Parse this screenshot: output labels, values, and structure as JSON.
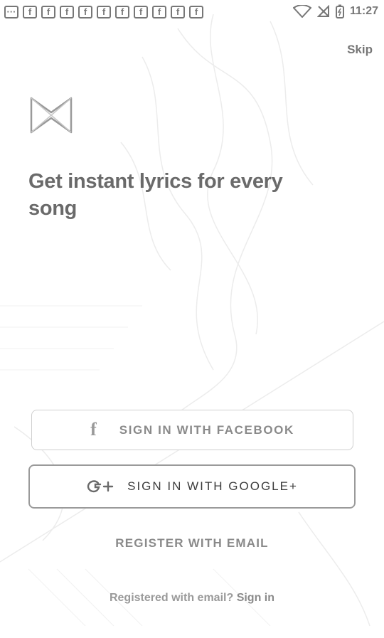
{
  "status_bar": {
    "notifications": [
      "f",
      "f",
      "f",
      "f",
      "f",
      "f",
      "f",
      "f",
      "f",
      "f",
      "f"
    ],
    "time": "11:27"
  },
  "onboarding": {
    "skip_label": "Skip",
    "headline": "Get instant lyrics for every song",
    "facebook_label": "SIGN IN WITH FACEBOOK",
    "google_label": "SIGN IN WITH GOOGLE+",
    "register_label": "REGISTER WITH EMAIL",
    "registered_prompt": "Registered with email?",
    "signin_link": "Sign in"
  },
  "icons": {
    "logo": "musixmatch-logo-icon",
    "facebook": "facebook-icon",
    "google": "google-plus-icon"
  }
}
